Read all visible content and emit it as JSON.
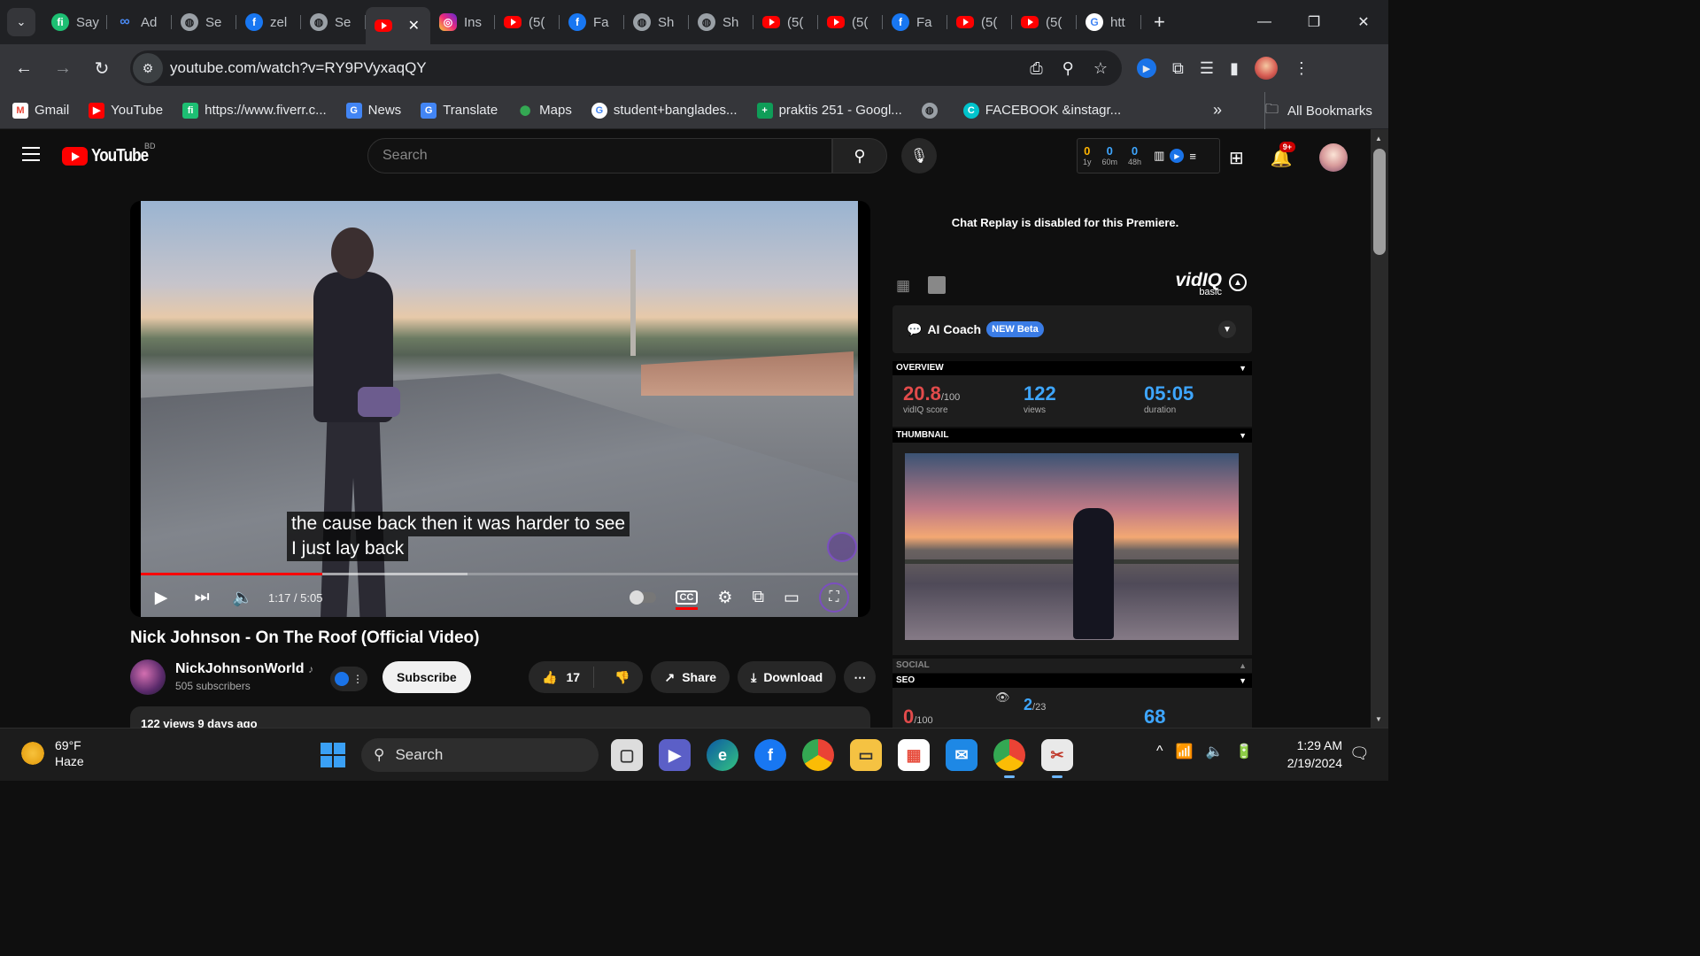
{
  "browser": {
    "tabs": [
      {
        "icon": "fiverr",
        "label": "Say"
      },
      {
        "icon": "meta",
        "label": "Ad"
      },
      {
        "icon": "globe",
        "label": "Se"
      },
      {
        "icon": "facebook",
        "label": "zel"
      },
      {
        "icon": "globe",
        "label": "Se"
      },
      {
        "icon": "youtube",
        "label": "",
        "active": true
      },
      {
        "icon": "instagram",
        "label": "Ins"
      },
      {
        "icon": "youtube",
        "label": "(5("
      },
      {
        "icon": "facebook",
        "label": "Fa"
      },
      {
        "icon": "globe",
        "label": "Sh"
      },
      {
        "icon": "globe",
        "label": "Sh"
      },
      {
        "icon": "youtube",
        "label": "(5("
      },
      {
        "icon": "youtube",
        "label": "(5("
      },
      {
        "icon": "facebook",
        "label": "Fa"
      },
      {
        "icon": "youtube",
        "label": "(5("
      },
      {
        "icon": "youtube",
        "label": "(5("
      },
      {
        "icon": "google",
        "label": "htt"
      }
    ],
    "url": "youtube.com/watch?v=RY9PVyxaqQY",
    "bookmarks": [
      {
        "icon": "gmail",
        "label": "Gmail"
      },
      {
        "icon": "youtube",
        "label": "YouTube"
      },
      {
        "icon": "fiverr",
        "label": "https://www.fiverr.c..."
      },
      {
        "icon": "news",
        "label": "News"
      },
      {
        "icon": "translate",
        "label": "Translate"
      },
      {
        "icon": "maps",
        "label": "Maps"
      },
      {
        "icon": "google",
        "label": "student+banglades..."
      },
      {
        "icon": "sheets",
        "label": "praktis 251 - Googl..."
      },
      {
        "icon": "globe",
        "label": ""
      },
      {
        "icon": "canva",
        "label": "FACEBOOK &instagr..."
      }
    ],
    "all_bookmarks": "All Bookmarks"
  },
  "youtube": {
    "logo_text": "YouTube",
    "country": "BD",
    "search_placeholder": "Search",
    "notif_badge": "9+",
    "vidiq_stats": [
      {
        "value": "0",
        "label": "1y"
      },
      {
        "value": "0",
        "label": "60m"
      },
      {
        "value": "0",
        "label": "48h"
      }
    ],
    "video": {
      "subtitle_line1": "the cause back then it was harder to see",
      "subtitle_line2": "I just lay back",
      "time": "1:17 / 5:05",
      "progress_played": 0.253,
      "progress_buffered": 0.455,
      "title": "Nick Johnson - On The Roof (Official Video)",
      "channel": "NickJohnsonWorld",
      "channel_note": "♪",
      "subscribers": "505 subscribers",
      "subscribe": "Subscribe",
      "likes": "17",
      "share": "Share",
      "download": "Download",
      "meta": "122 views  9 days ago"
    }
  },
  "sidebar": {
    "chat_note": "Chat Replay is disabled for this Premiere.",
    "vidiq_logo": "vidIQ",
    "vidiq_plan": "basic",
    "ai_coach": "AI Coach",
    "ai_badge": "NEW Beta",
    "overview_label": "OVERVIEW",
    "score": "20.8",
    "score_max": "/100",
    "score_label": "vidIQ score",
    "views": "122",
    "views_label": "views",
    "duration": "05:05",
    "duration_label": "duration",
    "thumbnail_label": "THUMBNAIL",
    "social_label": "SOCIAL",
    "seo_label": "SEO",
    "seo_score": "0",
    "seo_max": "/100",
    "seo_ratio": "2",
    "seo_ratio_max": "/23",
    "seo_value": "68"
  },
  "taskbar": {
    "temp": "69°F",
    "condition": "Haze",
    "search": "Search",
    "time": "1:29 AM",
    "date": "2/19/2024"
  },
  "colors": {
    "youtube_red": "#ff0000",
    "vidiq_blue": "#3ea6ff",
    "score_red": "#e24b4b"
  }
}
